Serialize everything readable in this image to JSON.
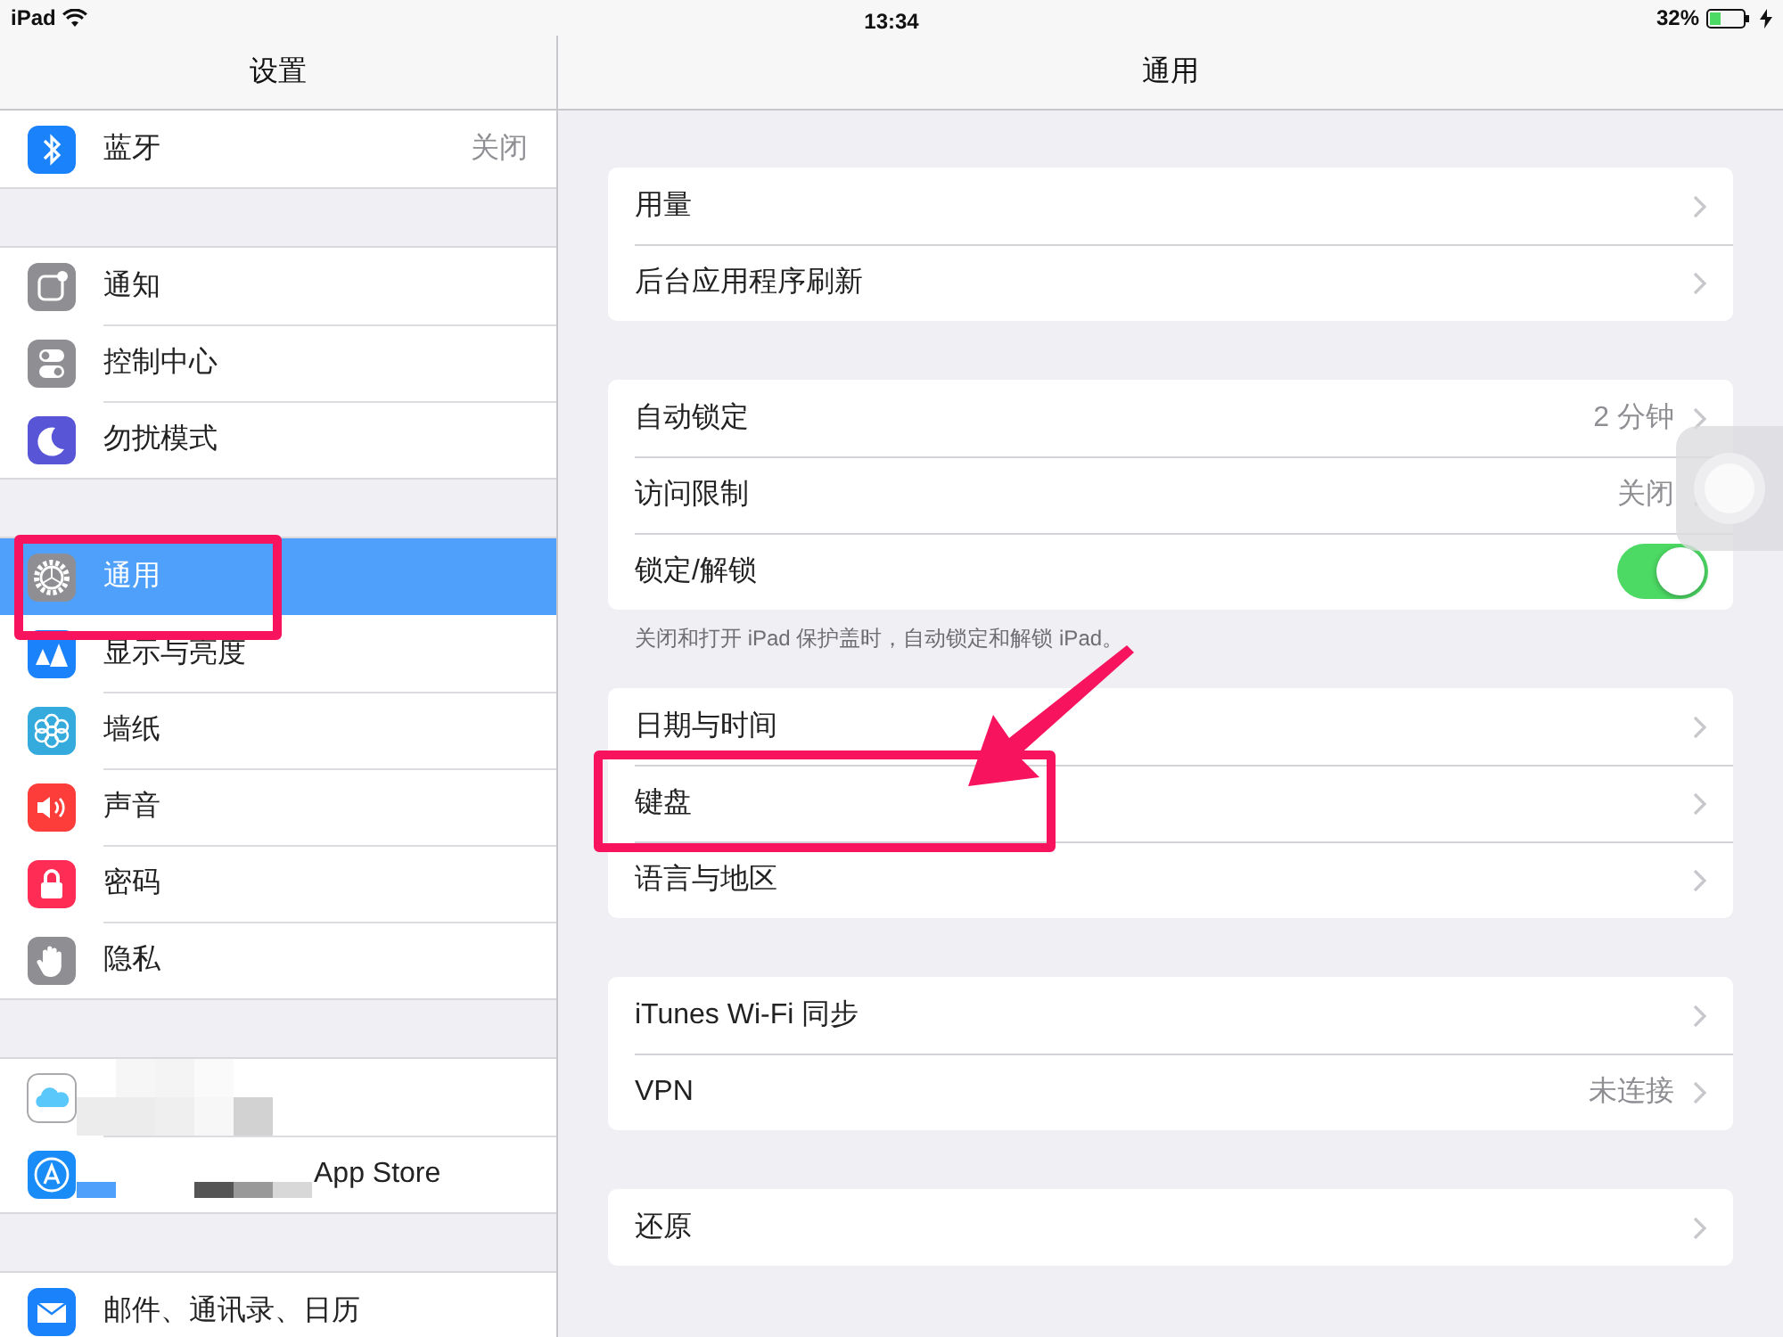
{
  "status_bar": {
    "device": "iPad",
    "time": "13:34",
    "battery": "32%"
  },
  "sidebar": {
    "title": "设置",
    "groups": [
      {
        "items": [
          {
            "label": "蓝牙",
            "value": "关闭",
            "selected": false,
            "annotated": false
          }
        ]
      },
      {
        "items": [
          {
            "label": "通知",
            "selected": false,
            "annotated": false
          },
          {
            "label": "控制中心",
            "selected": false,
            "annotated": false
          },
          {
            "label": "勿扰模式",
            "selected": false,
            "annotated": false
          }
        ]
      },
      {
        "items": [
          {
            "label": "通用",
            "selected": true,
            "annotated": true
          },
          {
            "label": "显示与亮度",
            "selected": false,
            "annotated": false
          },
          {
            "label": "墙纸",
            "selected": false,
            "annotated": false
          },
          {
            "label": "声音",
            "selected": false,
            "annotated": false
          },
          {
            "label": "密码",
            "selected": false,
            "annotated": false
          },
          {
            "label": "隐私",
            "selected": false,
            "annotated": false
          }
        ]
      },
      {
        "redacted": true,
        "items": [
          {
            "selected": false,
            "annotated": false
          },
          {
            "label": "App Store",
            "selected": false,
            "annotated": false
          }
        ]
      },
      {
        "items": [
          {
            "label": "邮件、通讯录、日历",
            "selected": false,
            "annotated": false
          }
        ]
      }
    ]
  },
  "detail": {
    "title": "通用",
    "groups": [
      {
        "rows": [
          {
            "kind": "link",
            "label": "用量",
            "annotated": false
          },
          {
            "kind": "link",
            "label": "后台应用程序刷新",
            "annotated": false
          }
        ]
      },
      {
        "rows": [
          {
            "kind": "link",
            "label": "自动锁定",
            "value": "2 分钟",
            "annotated": false
          },
          {
            "kind": "link",
            "label": "访问限制",
            "value": "关闭",
            "annotated": false
          },
          {
            "kind": "toggle",
            "label": "锁定/解锁",
            "on": true,
            "annotated": false
          }
        ],
        "footer": "关闭和打开 iPad 保护盖时，自动锁定和解锁 iPad。"
      },
      {
        "rows": [
          {
            "kind": "link",
            "label": "日期与时间",
            "annotated": false
          },
          {
            "kind": "link",
            "label": "键盘",
            "annotated": true
          },
          {
            "kind": "link",
            "label": "语言与地区",
            "annotated": false
          }
        ]
      },
      {
        "rows": [
          {
            "kind": "link",
            "label": "iTunes Wi-Fi 同步",
            "annotated": false
          },
          {
            "kind": "link",
            "label": "VPN",
            "value": "未连接",
            "annotated": false
          }
        ]
      },
      {
        "rows": [
          {
            "kind": "link",
            "label": "还原",
            "annotated": false
          }
        ]
      }
    ]
  }
}
